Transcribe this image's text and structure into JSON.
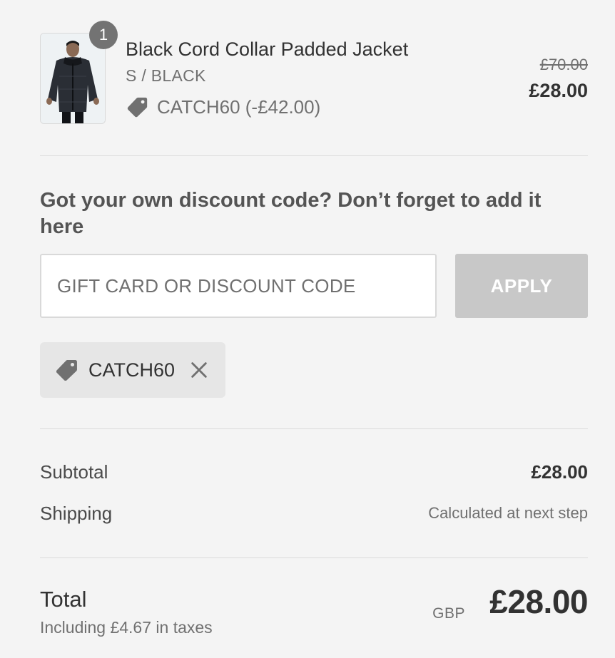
{
  "product": {
    "image_alt": "Black Cord Collar Padded Jacket",
    "quantity": "1",
    "title": "Black Cord Collar Padded Jacket",
    "variant": "S / BLACK",
    "discount_label": "CATCH60 (-£42.00)",
    "discount_icon": "tag-icon",
    "original_price": "£70.00",
    "price": "£28.00"
  },
  "discount": {
    "heading": "Got your own discount code? Don’t forget to add it here",
    "input_placeholder": "GIFT CARD OR DISCOUNT CODE",
    "input_value": "",
    "apply_label": "APPLY",
    "applied_code": "CATCH60",
    "remove_icon": "close-icon"
  },
  "summary": {
    "subtotal_label": "Subtotal",
    "subtotal_value": "£28.00",
    "shipping_label": "Shipping",
    "shipping_value": "Calculated at next step"
  },
  "total": {
    "label": "Total",
    "taxes_note": "Including £4.67 in taxes",
    "currency": "GBP",
    "amount": "£28.00"
  },
  "colors": {
    "background": "#f4f4f4",
    "text_primary": "#323232",
    "text_secondary": "#707070",
    "apply_button": "#c8c8c8",
    "chip_background": "#e6e6e6",
    "badge": "#737373"
  }
}
